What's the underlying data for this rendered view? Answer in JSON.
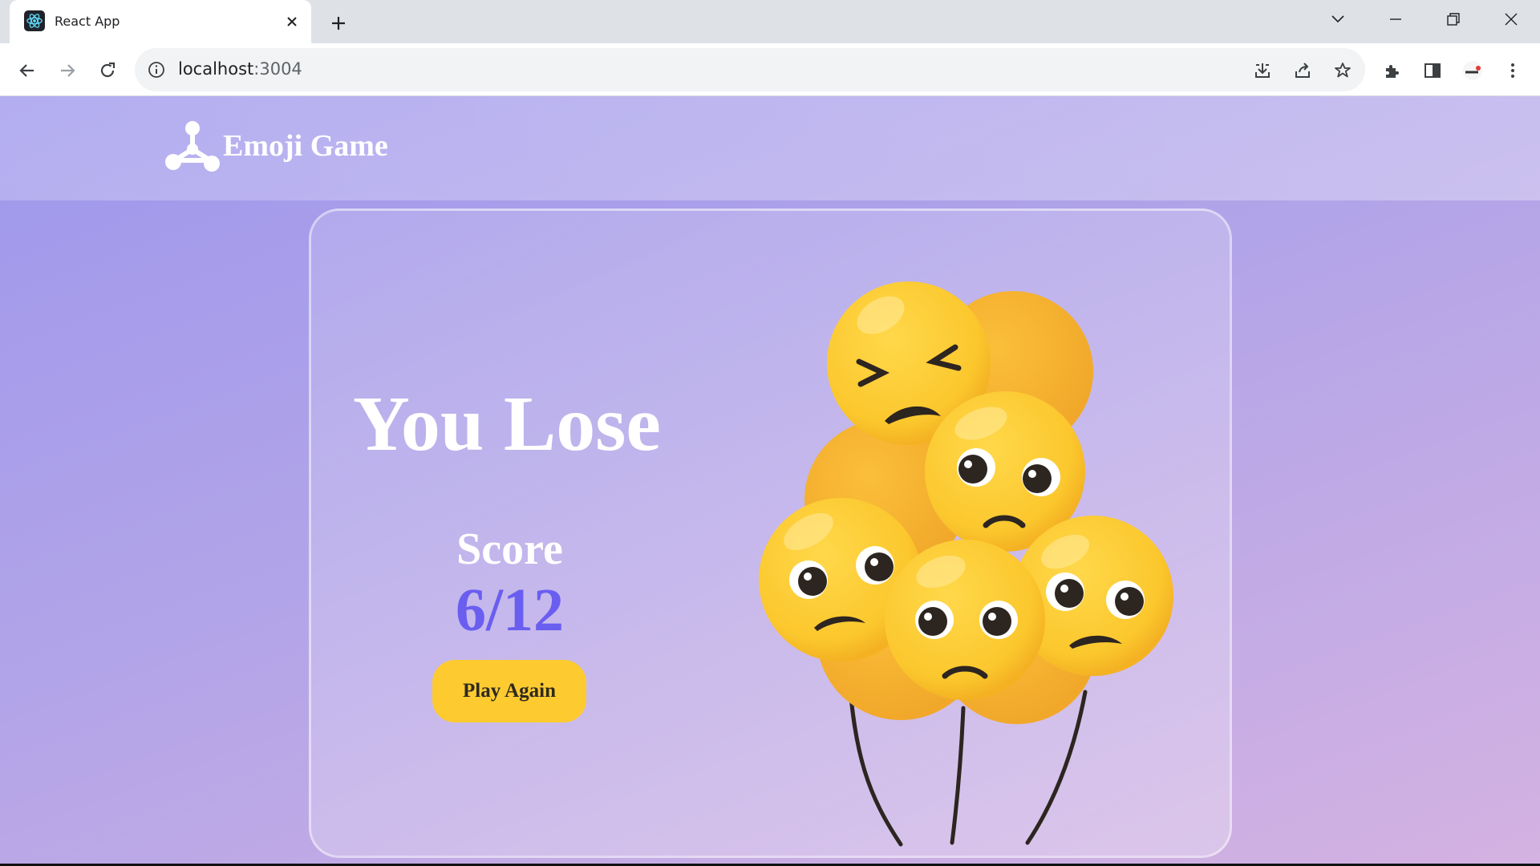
{
  "browser": {
    "tab_title": "React App",
    "url_host": "localhost",
    "url_port": ":3004"
  },
  "app": {
    "brand": "Emoji Game",
    "result_title": "You Lose",
    "score_label": "Score",
    "score_value": "6/12",
    "play_again_label": "Play Again"
  },
  "colors": {
    "accent": "#6a5ef0",
    "button": "#fdcb2f"
  },
  "icons": [
    "react-icon",
    "close-icon",
    "plus-icon",
    "chevron-down-icon",
    "minimize-icon",
    "restore-icon",
    "window-close-icon",
    "back-icon",
    "forward-icon",
    "reload-icon",
    "info-icon",
    "install-icon",
    "share-icon",
    "star-icon",
    "extensions-icon",
    "side-panel-icon",
    "profile-icon",
    "menu-icon",
    "logo-icon"
  ]
}
